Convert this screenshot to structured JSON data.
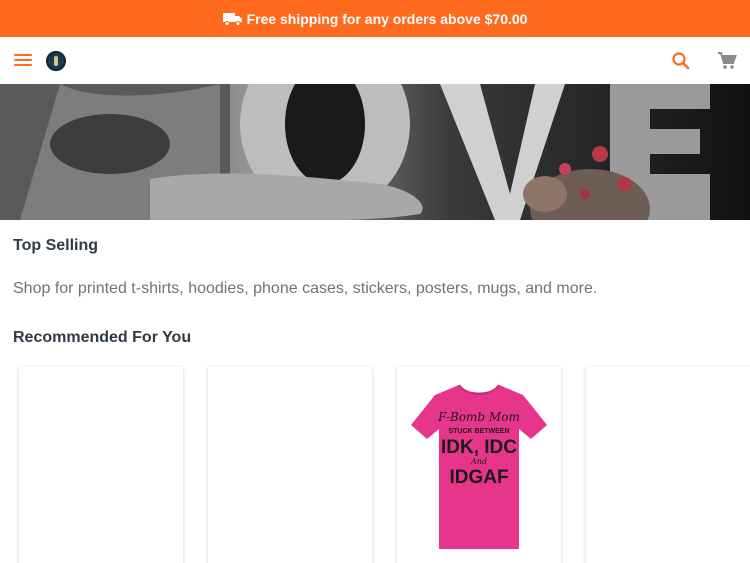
{
  "promo": {
    "text": "Free shipping for any orders above $70.00",
    "icon": "truck-icon",
    "background": "#ff6a1f"
  },
  "header": {
    "menu_icon": "hamburger-menu-icon",
    "logo": "brand-logo",
    "search_icon": "search-icon",
    "cart_icon": "shopping-cart-icon",
    "accent": "#ff6a1f"
  },
  "hero": {
    "image": "love-banner-image"
  },
  "sections": {
    "top_selling": "Top Selling",
    "description": "Shop for printed t-shirts, hoodies, phone cases, stickers, posters, mugs, and more.",
    "recommended": "Recommended For You"
  },
  "products": [
    {
      "image": "blank"
    },
    {
      "image": "blank"
    },
    {
      "image": "pink-tshirt",
      "shirt_lines": [
        "F-Bomb Mom",
        "STUCK BETWEEN",
        "IDK, IDC",
        "And",
        "IDGAF"
      ]
    },
    {
      "image": "blank"
    }
  ]
}
